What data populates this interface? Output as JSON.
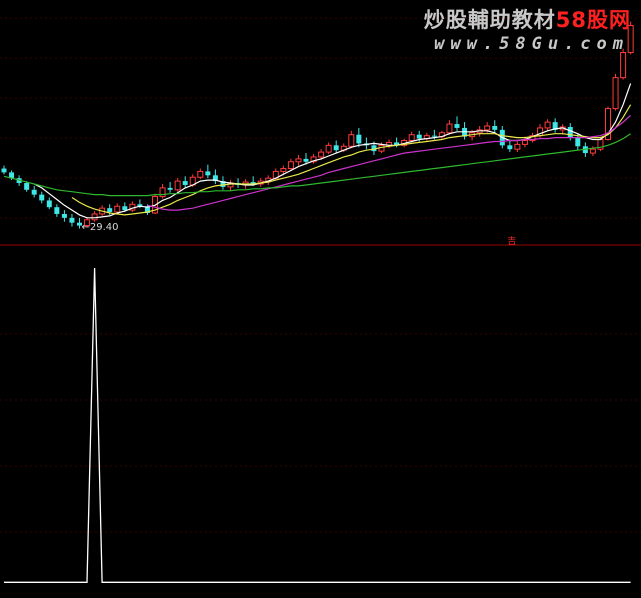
{
  "watermark": {
    "text_main": "炒股輔助教材",
    "text_brand": "58股网",
    "url": "www.58Gu.com",
    "color_main": "#c8c8c8",
    "color_brand": "#ff2020"
  },
  "colors": {
    "background": "#000000",
    "up_candle": "#ff3b3b",
    "down_candle": "#3fe6e6",
    "ma_white": "#ffffff",
    "ma_yellow": "#e8e84a",
    "ma_magenta": "#cc33cc",
    "ma_green": "#2eb82e",
    "divider": "#990000",
    "grid": "#3a0000",
    "indicator": "#ffffff"
  },
  "chart_data": [
    {
      "type": "candlestick",
      "title": "",
      "min_price_label": "29.40",
      "marker_label": "吉",
      "grid": true,
      "candles": [
        [
          35.6,
          35.9,
          35.0,
          35.2
        ],
        [
          35.2,
          35.4,
          34.4,
          34.6
        ],
        [
          34.6,
          34.9,
          33.8,
          34.1
        ],
        [
          34.1,
          34.3,
          33.2,
          33.4
        ],
        [
          33.4,
          33.8,
          32.6,
          32.9
        ],
        [
          32.9,
          33.2,
          32.0,
          32.3
        ],
        [
          32.3,
          32.6,
          31.4,
          31.6
        ],
        [
          31.6,
          31.9,
          30.6,
          30.9
        ],
        [
          30.9,
          31.3,
          30.1,
          30.5
        ],
        [
          30.5,
          30.9,
          29.6,
          30.0
        ],
        [
          30.0,
          30.5,
          29.4,
          29.7
        ],
        [
          29.7,
          30.6,
          29.5,
          30.3
        ],
        [
          30.3,
          31.2,
          30.1,
          30.9
        ],
        [
          30.9,
          31.8,
          30.7,
          31.5
        ],
        [
          31.5,
          31.9,
          30.8,
          31.1
        ],
        [
          31.1,
          32.0,
          30.9,
          31.7
        ],
        [
          31.7,
          32.1,
          31.1,
          31.3
        ],
        [
          31.3,
          32.2,
          31.1,
          31.9
        ],
        [
          31.9,
          32.4,
          31.5,
          31.7
        ],
        [
          31.7,
          31.9,
          30.8,
          31.0
        ],
        [
          31.0,
          33.0,
          30.9,
          32.7
        ],
        [
          32.7,
          34.0,
          32.5,
          33.6
        ],
        [
          33.6,
          34.2,
          33.1,
          33.4
        ],
        [
          33.4,
          34.6,
          33.2,
          34.3
        ],
        [
          34.3,
          34.8,
          33.6,
          33.9
        ],
        [
          33.9,
          35.0,
          33.7,
          34.7
        ],
        [
          34.7,
          35.6,
          34.5,
          35.3
        ],
        [
          35.3,
          36.0,
          34.6,
          34.9
        ],
        [
          34.9,
          35.5,
          34.0,
          34.3
        ],
        [
          34.3,
          34.8,
          33.4,
          33.7
        ],
        [
          33.7,
          34.4,
          33.3,
          34.1
        ],
        [
          34.1,
          34.6,
          33.6,
          33.9
        ],
        [
          33.9,
          34.5,
          33.5,
          34.2
        ],
        [
          34.2,
          34.8,
          33.8,
          34.0
        ],
        [
          34.0,
          34.6,
          33.7,
          34.3
        ],
        [
          34.3,
          34.9,
          33.9,
          34.6
        ],
        [
          34.6,
          35.6,
          34.4,
          35.3
        ],
        [
          35.3,
          35.9,
          34.9,
          35.6
        ],
        [
          35.6,
          36.6,
          35.4,
          36.3
        ],
        [
          36.3,
          37.0,
          35.9,
          36.6
        ],
        [
          36.6,
          37.2,
          36.0,
          36.3
        ],
        [
          36.3,
          37.1,
          36.1,
          36.8
        ],
        [
          36.8,
          37.6,
          36.5,
          37.3
        ],
        [
          37.3,
          38.3,
          37.1,
          38.0
        ],
        [
          38.0,
          38.5,
          37.2,
          37.5
        ],
        [
          37.5,
          38.2,
          37.3,
          37.9
        ],
        [
          37.9,
          39.5,
          37.7,
          39.1
        ],
        [
          39.1,
          39.8,
          37.8,
          38.2
        ],
        [
          38.2,
          38.8,
          37.6,
          38.0
        ],
        [
          38.0,
          38.4,
          37.0,
          37.4
        ],
        [
          37.4,
          38.3,
          37.2,
          38.0
        ],
        [
          38.0,
          38.6,
          37.7,
          38.3
        ],
        [
          38.3,
          38.8,
          37.8,
          38.0
        ],
        [
          38.0,
          38.7,
          37.8,
          38.5
        ],
        [
          38.5,
          39.4,
          38.3,
          39.1
        ],
        [
          39.1,
          39.5,
          38.4,
          38.7
        ],
        [
          38.7,
          39.3,
          38.5,
          39.0
        ],
        [
          39.0,
          39.6,
          38.6,
          38.9
        ],
        [
          38.9,
          39.5,
          38.7,
          39.3
        ],
        [
          39.3,
          40.6,
          39.1,
          40.2
        ],
        [
          40.2,
          41.0,
          39.5,
          39.8
        ],
        [
          39.8,
          40.4,
          38.6,
          38.9
        ],
        [
          38.9,
          39.6,
          38.5,
          39.3
        ],
        [
          39.3,
          40.0,
          38.9,
          39.6
        ],
        [
          39.6,
          40.4,
          39.3,
          40.0
        ],
        [
          40.0,
          40.6,
          39.3,
          39.6
        ],
        [
          39.6,
          40.0,
          37.7,
          38.0
        ],
        [
          38.0,
          38.6,
          37.3,
          37.6
        ],
        [
          37.6,
          38.4,
          37.3,
          38.1
        ],
        [
          38.1,
          38.9,
          37.8,
          38.5
        ],
        [
          38.5,
          39.3,
          38.3,
          39.0
        ],
        [
          39.0,
          40.2,
          38.8,
          39.8
        ],
        [
          39.8,
          40.7,
          39.5,
          40.4
        ],
        [
          40.4,
          40.8,
          39.3,
          39.6
        ],
        [
          39.6,
          40.2,
          39.1,
          39.9
        ],
        [
          39.9,
          40.3,
          38.5,
          38.8
        ],
        [
          38.8,
          39.2,
          37.5,
          37.9
        ],
        [
          37.9,
          38.3,
          36.8,
          37.2
        ],
        [
          37.2,
          37.9,
          36.9,
          37.6
        ],
        [
          37.6,
          38.8,
          37.4,
          38.6
        ],
        [
          38.6,
          42.0,
          38.5,
          41.8
        ],
        [
          41.8,
          45.4,
          41.6,
          45.0
        ],
        [
          45.0,
          48.0,
          44.8,
          47.6
        ],
        [
          47.6,
          50.8,
          47.4,
          50.4
        ]
      ],
      "series": [
        {
          "key": "ma_white",
          "values": [
            null,
            null,
            null,
            null,
            34.0,
            33.6,
            33.0,
            32.4,
            31.8,
            31.3,
            30.8,
            30.5,
            30.5,
            30.6,
            30.7,
            31.0,
            31.2,
            31.5,
            31.7,
            31.6,
            31.8,
            32.3,
            32.6,
            33.1,
            33.6,
            33.9,
            34.3,
            34.4,
            34.4,
            34.2,
            34.1,
            34.0,
            33.9,
            33.9,
            34.1,
            34.3,
            34.6,
            35.0,
            35.4,
            35.8,
            36.1,
            36.4,
            36.6,
            36.9,
            37.2,
            37.5,
            37.8,
            38.0,
            38.1,
            38.2,
            38.1,
            38.0,
            38.0,
            38.2,
            38.4,
            38.6,
            38.7,
            38.8,
            38.9,
            39.2,
            39.4,
            39.4,
            39.4,
            39.5,
            39.5,
            39.3,
            38.8,
            38.5,
            38.5,
            38.6,
            38.9,
            39.2,
            39.5,
            39.7,
            39.8,
            39.5,
            39.2,
            38.8,
            38.6,
            38.6,
            39.2,
            40.4,
            42.2,
            44.4
          ]
        },
        {
          "key": "ma_yellow",
          "values": [
            null,
            null,
            null,
            null,
            null,
            null,
            null,
            null,
            null,
            32.6,
            32.1,
            31.7,
            31.4,
            31.2,
            31.0,
            30.9,
            30.8,
            30.9,
            31.0,
            31.1,
            31.3,
            31.6,
            31.9,
            32.3,
            32.6,
            32.9,
            33.3,
            33.6,
            33.8,
            33.9,
            34.0,
            34.0,
            34.0,
            34.0,
            34.1,
            34.2,
            34.4,
            34.6,
            34.8,
            35.0,
            35.3,
            35.6,
            35.9,
            36.2,
            36.5,
            36.8,
            37.0,
            37.3,
            37.5,
            37.6,
            37.8,
            37.9,
            38.0,
            38.1,
            38.2,
            38.3,
            38.4,
            38.5,
            38.6,
            38.8,
            38.9,
            39.0,
            39.1,
            39.2,
            39.2,
            39.2,
            39.0,
            38.9,
            38.8,
            38.8,
            38.9,
            39.0,
            39.1,
            39.2,
            39.2,
            39.1,
            39.0,
            38.9,
            38.8,
            38.8,
            39.1,
            39.8,
            40.9,
            42.2
          ]
        },
        {
          "key": "ma_magenta",
          "values": [
            null,
            null,
            null,
            null,
            null,
            null,
            null,
            null,
            null,
            null,
            null,
            null,
            null,
            null,
            null,
            null,
            null,
            null,
            null,
            31.8,
            31.6,
            31.4,
            31.3,
            31.3,
            31.4,
            31.5,
            31.7,
            31.9,
            32.1,
            32.3,
            32.5,
            32.7,
            32.9,
            33.1,
            33.3,
            33.5,
            33.7,
            33.9,
            34.1,
            34.3,
            34.5,
            34.7,
            34.9,
            35.2,
            35.4,
            35.6,
            35.8,
            36.0,
            36.2,
            36.4,
            36.6,
            36.8,
            37.0,
            37.2,
            37.3,
            37.4,
            37.5,
            37.6,
            37.7,
            37.8,
            37.9,
            38.0,
            38.1,
            38.2,
            38.3,
            38.4,
            38.4,
            38.5,
            38.5,
            38.6,
            38.6,
            38.7,
            38.7,
            38.8,
            38.8,
            38.8,
            38.8,
            38.8,
            38.9,
            39.0,
            39.3,
            39.8,
            40.4,
            41.1
          ]
        },
        {
          "key": "ma_green",
          "values": [
            34.8,
            34.6,
            34.4,
            34.2,
            34.0,
            33.8,
            33.6,
            33.4,
            33.3,
            33.2,
            33.1,
            33.0,
            32.9,
            32.9,
            32.8,
            32.8,
            32.8,
            32.8,
            32.8,
            32.8,
            32.9,
            32.9,
            33.0,
            33.0,
            33.1,
            33.1,
            33.2,
            33.2,
            33.3,
            33.3,
            33.3,
            33.4,
            33.4,
            33.5,
            33.5,
            33.6,
            33.6,
            33.7,
            33.8,
            33.8,
            33.9,
            34.0,
            34.1,
            34.2,
            34.3,
            34.4,
            34.5,
            34.6,
            34.7,
            34.8,
            34.9,
            35.0,
            35.1,
            35.2,
            35.3,
            35.4,
            35.5,
            35.6,
            35.7,
            35.8,
            35.9,
            36.0,
            36.1,
            36.2,
            36.3,
            36.4,
            36.5,
            36.6,
            36.7,
            36.8,
            36.9,
            37.0,
            37.1,
            37.2,
            37.3,
            37.4,
            37.5,
            37.6,
            37.7,
            37.8,
            38.0,
            38.3,
            38.7,
            39.2
          ]
        }
      ],
      "ylim": [
        28.0,
        52.0
      ]
    },
    {
      "type": "line",
      "title": "",
      "grid": true,
      "spike_index": 12,
      "values": [
        0,
        0,
        0,
        0,
        0,
        0,
        0,
        0,
        0,
        0,
        0,
        0,
        100,
        0,
        0,
        0,
        0,
        0,
        0,
        0,
        0,
        0,
        0,
        0,
        0,
        0,
        0,
        0,
        0,
        0,
        0,
        0,
        0,
        0,
        0,
        0,
        0,
        0,
        0,
        0,
        0,
        0,
        0,
        0,
        0,
        0,
        0,
        0,
        0,
        0,
        0,
        0,
        0,
        0,
        0,
        0,
        0,
        0,
        0,
        0,
        0,
        0,
        0,
        0,
        0,
        0,
        0,
        0,
        0,
        0,
        0,
        0,
        0,
        0,
        0,
        0,
        0,
        0,
        0,
        0,
        0,
        0,
        0,
        0
      ],
      "ylim": [
        -5,
        100
      ]
    }
  ]
}
